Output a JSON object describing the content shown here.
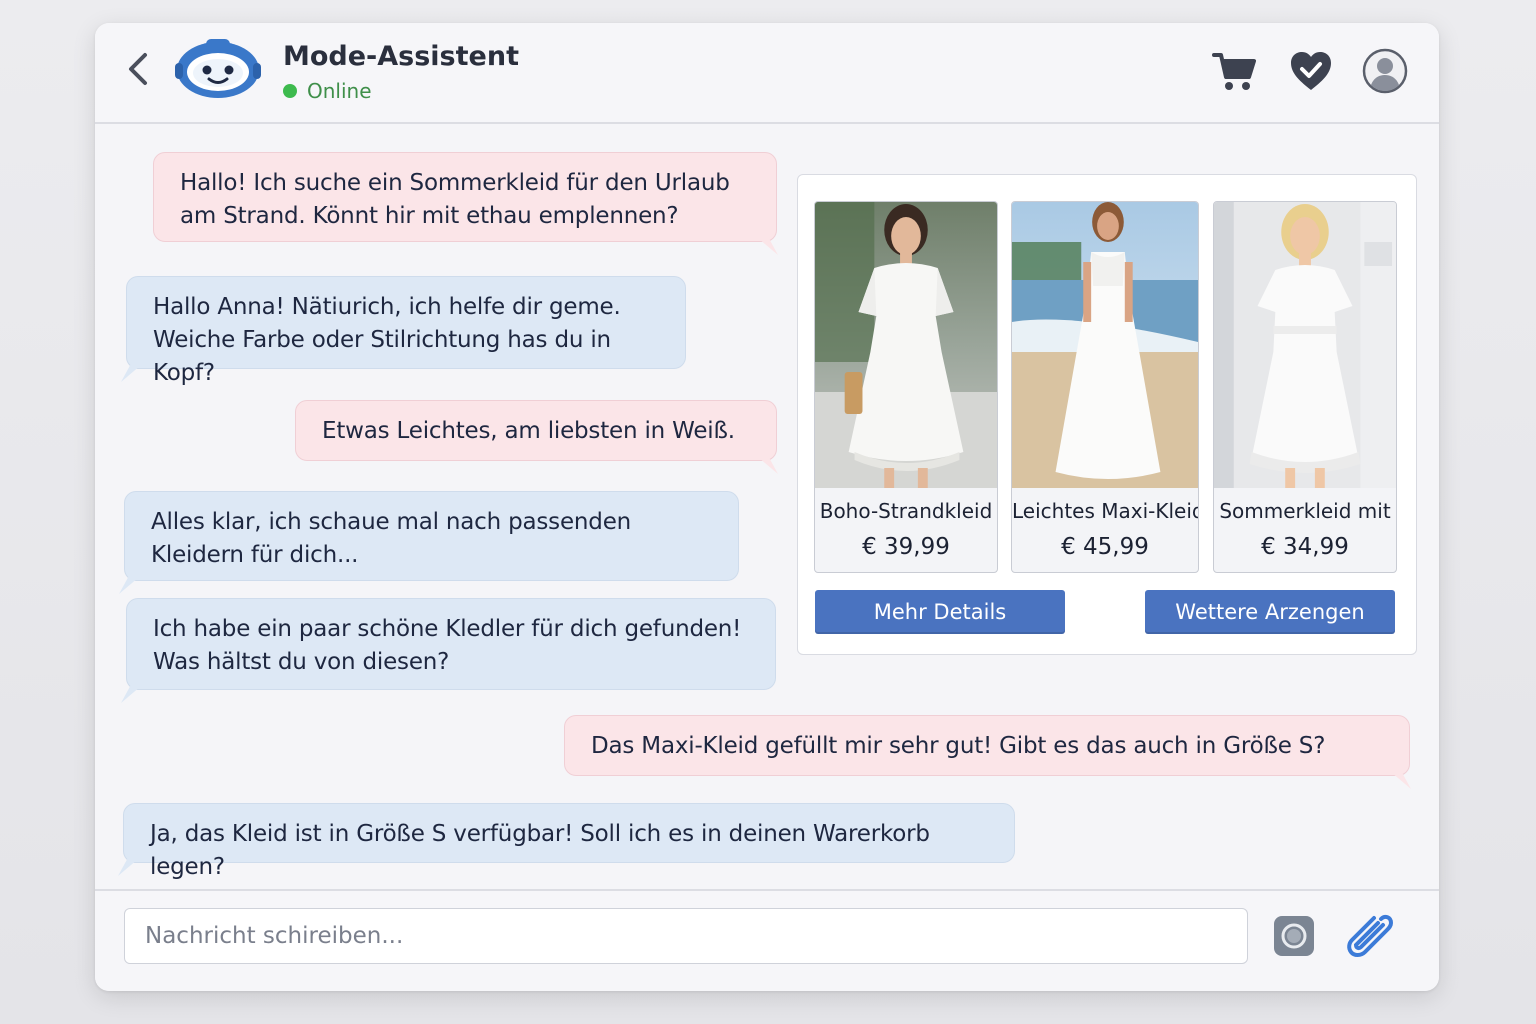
{
  "header": {
    "title": "Mode-Assistent",
    "status": "Online",
    "icons": [
      "chevron-left-icon",
      "robot-avatar",
      "cart-icon",
      "heart-check-icon",
      "user-icon"
    ]
  },
  "messages": [
    {
      "from": "user",
      "text": "Hallo! Ich suche ein Sommerkleid für den Urlaub am Strand. Könnt hir mit ethau emplennen?"
    },
    {
      "from": "bot",
      "text": "Hallo Anna! Nätiurich, ich helfe dir geme. Weiche Farbe oder Stilrichtung has du in Kopf?"
    },
    {
      "from": "user",
      "text": "Etwas Leichtes, am liebsten in Weiß."
    },
    {
      "from": "bot",
      "text": "Alles klar, ich schaue mal nach passenden Kleidern für dich..."
    },
    {
      "from": "bot",
      "text": "Ich habe ein paar schöne Kledler für dich gefunden! Was hältst du von diesen?"
    },
    {
      "from": "user",
      "text": "Das Maxi-Kleid gefüllt mir sehr gut! Gibt es das auch in Größe S?"
    },
    {
      "from": "bot",
      "text": "Ja, das Kleid ist in Größe S verfügbar! Soll ich es in deinen Warerkorb legen?"
    }
  ],
  "products": [
    {
      "name": "Boho-Strandkleid",
      "price": "€ 39,99"
    },
    {
      "name": "Leichtes Maxi-Kleid",
      "price": "€ 45,99"
    },
    {
      "name": "Sommerkleid mit",
      "price": "€ 34,99"
    }
  ],
  "panel_buttons": {
    "details": "Mehr Details",
    "more": "Wettere Arzengen"
  },
  "composer": {
    "placeholder": "Nachricht schireiben..."
  },
  "colors": {
    "accent": "#4a73c0",
    "user_bubble": "#fbe5e8",
    "bot_bubble": "#dde8f5",
    "online": "#3dba4e"
  }
}
